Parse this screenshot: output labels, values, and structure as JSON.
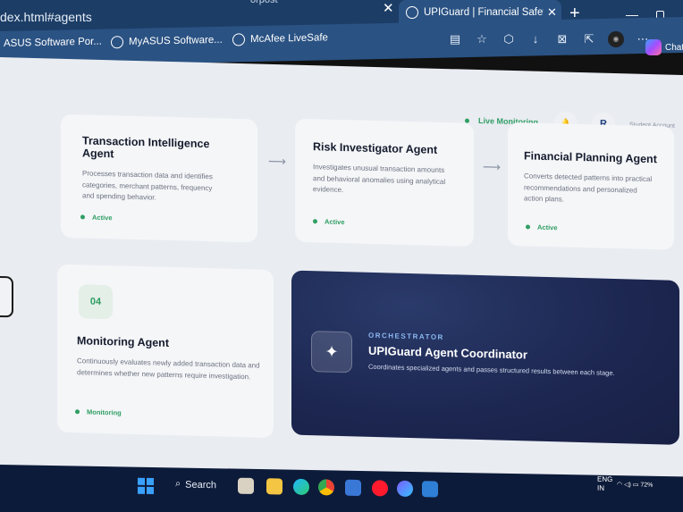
{
  "browser": {
    "url_fragment": "dex.html#agents",
    "prev_tab_partial": "orpost",
    "active_tab_title": "UPIGuard | Financial Safety Agents",
    "new_tab_symbol": "+",
    "chat_label": "Chat",
    "bookmarks": [
      "ASUS Software Por...",
      "MyASUS Software...",
      "McAfee LiveSafe"
    ]
  },
  "header": {
    "live_label": "Live Monitoring",
    "user_initial": "R",
    "user_label": "Student Account"
  },
  "agents": [
    {
      "title": "Transaction Intelligence Agent",
      "description": "Processes transaction data and identifies categories, merchant patterns, frequency and spending behavior.",
      "status": "Active"
    },
    {
      "title": "Risk Investigator Agent",
      "description": "Investigates unusual transaction amounts and behavioral anomalies using analytical evidence.",
      "status": "Active"
    },
    {
      "title": "Financial Planning Agent",
      "description": "Converts detected patterns into practical recommendations and personalized action plans.",
      "status": "Active"
    },
    {
      "number": "04",
      "title": "Monitoring Agent",
      "description": "Continuously evaluates newly added transaction data and determines whether new patterns require investigation.",
      "status": "Monitoring"
    }
  ],
  "orchestrator": {
    "tag": "ORCHESTRATOR",
    "title": "UPIGuard Agent Coordinator",
    "description": "Coordinates specialized agents and passes structured results between each stage.",
    "icon": "sparkle-icon"
  },
  "taskbar": {
    "search_label": "Search",
    "lang_line1": "ENG",
    "lang_line2": "IN",
    "battery": "72%"
  },
  "colors": {
    "accent_green": "#2f9e63",
    "orchestrator_bg": "#1c2650",
    "browser_bar": "#2a5283"
  }
}
